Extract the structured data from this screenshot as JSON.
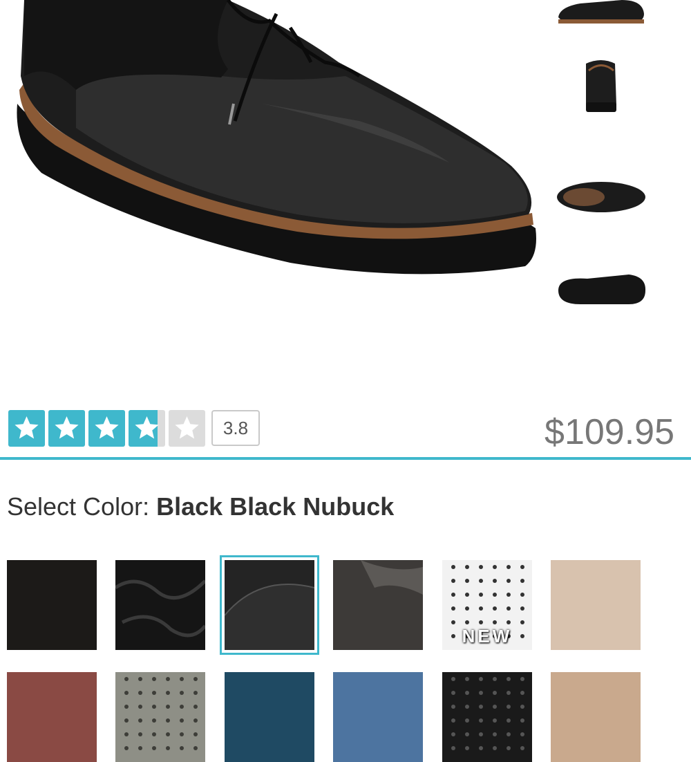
{
  "product": {
    "main_image": "black-oxford-shoe-photo",
    "thumbnails": [
      {
        "name": "thumb-side-view"
      },
      {
        "name": "thumb-back-view"
      },
      {
        "name": "thumb-top-view"
      },
      {
        "name": "thumb-sole-view"
      }
    ]
  },
  "rating": {
    "value": "3.8",
    "stars_filled": 3.8,
    "stars_total": 5,
    "color": "#3fb8cc"
  },
  "price": "$109.95",
  "color_select": {
    "label": "Select Color: ",
    "selected_name": "Black Black Nubuck"
  },
  "swatches": [
    {
      "name": "swatch-black-suede",
      "color": "#1c1a18",
      "selected": false
    },
    {
      "name": "swatch-black-patent",
      "color": "#151515",
      "selected": false
    },
    {
      "name": "swatch-black-black-nubuck",
      "color": "#242424",
      "selected": true
    },
    {
      "name": "swatch-dark-grey-leather",
      "color": "#3d3a38",
      "selected": false
    },
    {
      "name": "swatch-white-perforated",
      "color": "#f2f2f2",
      "selected": false,
      "badge": "NEW"
    },
    {
      "name": "swatch-taupe",
      "color": "#d8c2ae",
      "selected": false
    },
    {
      "name": "swatch-burgundy",
      "color": "#8a4a44",
      "selected": false
    },
    {
      "name": "swatch-grey-perforated",
      "color": "#8e8f86",
      "selected": false
    },
    {
      "name": "swatch-navy",
      "color": "#1f4a63",
      "selected": false
    },
    {
      "name": "swatch-blue-denim",
      "color": "#4d74a0",
      "selected": false
    },
    {
      "name": "swatch-black-perforated",
      "color": "#1a1a1a",
      "selected": false
    },
    {
      "name": "swatch-light-tan",
      "color": "#c9a98d",
      "selected": false
    }
  ],
  "icons": {
    "star": "star-icon"
  }
}
